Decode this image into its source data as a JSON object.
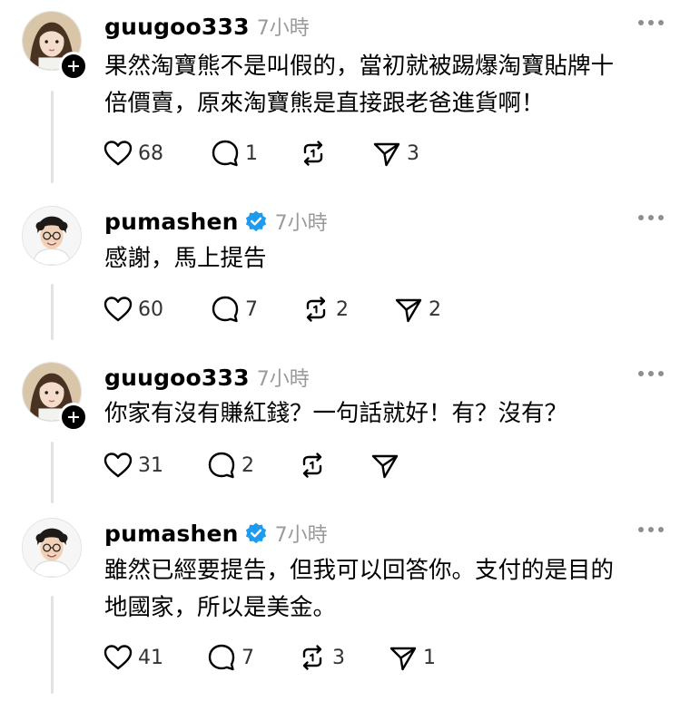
{
  "posts": [
    {
      "username": "guugoo333",
      "time": "7小時",
      "verified": false,
      "text": "果然淘寶熊不是叫假的，當初就被踢爆淘寶貼牌十\n倍價賣，原來淘寶熊是直接跟老爸進貨啊！",
      "likes": "68",
      "replies": "1",
      "reposts": "",
      "shares": "3"
    },
    {
      "username": "pumashen",
      "time": "7小時",
      "verified": true,
      "text": "感謝，馬上提告",
      "likes": "60",
      "replies": "7",
      "reposts": "2",
      "shares": "2"
    },
    {
      "username": "guugoo333",
      "time": "7小時",
      "verified": false,
      "text": "你家有沒有賺紅錢？一句話就好！有？沒有？",
      "likes": "31",
      "replies": "2",
      "reposts": "",
      "shares": ""
    },
    {
      "username": "pumashen",
      "time": "7小時",
      "verified": true,
      "text": "雖然已經要提告，但我可以回答你。支付的是目的\n地國家，所以是美金。",
      "likes": "41",
      "replies": "7",
      "reposts": "3",
      "shares": "1"
    }
  ],
  "colors": {
    "verified_badge": "#1d9bf0",
    "secondary_text": "#9a9a9a",
    "thread_line": "#e2e2e2"
  }
}
